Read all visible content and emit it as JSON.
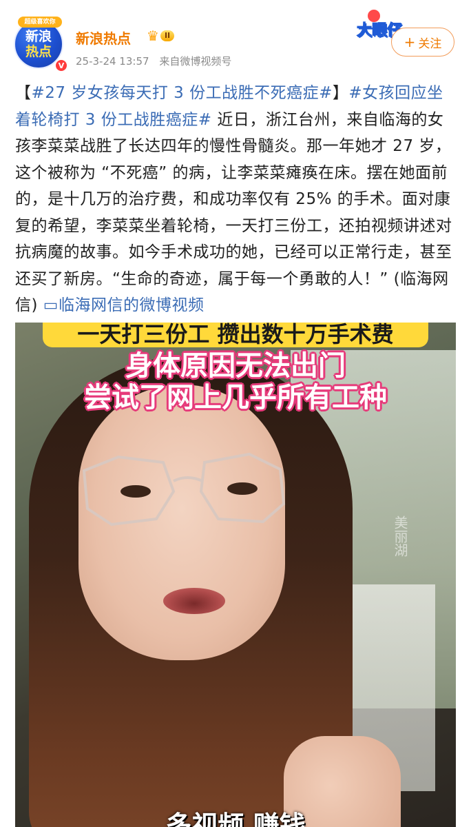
{
  "account": {
    "avatar_line1": "新浪",
    "avatar_line2": "热点",
    "avatar_ribbon": "超级喜欢你",
    "verified_mark": "V",
    "name": "新浪热点",
    "vip_level": "II",
    "timestamp": "25-3-24 13:57",
    "source": "来自微博视频号"
  },
  "sticker": {
    "text": "大眼仔"
  },
  "follow_button": {
    "plus": "+",
    "label": "关注"
  },
  "post": {
    "bracket_open": "【",
    "tag1": "#27 岁女孩每天打 3 份工战胜不死癌症#",
    "bracket_close": "】",
    "tag2": "#女孩回应坐着轮椅打 3 份工战胜癌症#",
    "body": " 近日，浙江台州，来自临海的女孩李菜菜战胜了长达四年的慢性骨髓炎。那一年她才 27 岁，这个被称为 “不死癌” 的病，让李菜菜瘫痪在床。摆在她面前的，是十几万的治疗费，和成功率仅有 25% 的手术。面对康复的希望，李菜菜坐着轮椅，一天打三份工，还拍视频讲述对抗病魔的故事。如今手术成功的她，已经可以正常行走，甚至还买了新房。“生命的奇迹，属于每一个勇敢的人！” (临海网信) ",
    "video_icon": "▭",
    "video_link": "临海网信的微博视频"
  },
  "video": {
    "banner_text": "一天打三份工 攒出数十万手术费",
    "caption_line1": "身体原因无法出门",
    "caption_line2": "尝试了网上几乎所有工种",
    "bottom_caption": "多视频 赚钱",
    "watermark": "美丽湖"
  },
  "colors": {
    "username": "#ef7a00",
    "link": "#3b6cb5",
    "follow_border": "#f29b58",
    "banner": "#ffd93a",
    "caption_outline": "#e63a7a"
  }
}
